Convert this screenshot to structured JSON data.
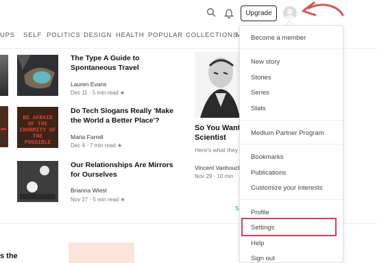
{
  "header": {
    "upgrade_label": "Upgrade"
  },
  "nav": {
    "items": [
      "UPS",
      "SELF",
      "POLITICS",
      "DESIGN",
      "HEALTH",
      "POPULAR",
      "COLLECTIONS",
      "M"
    ]
  },
  "articles": [
    {
      "title": "The Type A Guide to Spontaneous Travel",
      "author": "Lauren Evans",
      "meta": "Dec 11 · 5 min read ★"
    },
    {
      "title": "Do Tech Slogans Really 'Make the World a Better Place'?",
      "author": "Maria Farrell",
      "meta": "Dec 4 · 7 min read ★"
    },
    {
      "title": "Our Relationships Are Mirrors for Ourselves",
      "author": "Brianna Wiest",
      "meta": "Nov 27 · 5 min read ★"
    }
  ],
  "thumb2_text": "BE AFRAID OF THE ENORMITY OF THE POSSIBLE",
  "featured": {
    "title": "So You Want Scientist",
    "subtitle": "Here's what they",
    "author": "Vincent Vanhouck",
    "meta": "Nov 29 · 10 min",
    "see_more": "S"
  },
  "bottom_left": "s the",
  "menu": {
    "become_member": "Become a member",
    "new_story": "New story",
    "stories": "Stories",
    "series": "Series",
    "stats": "Stats",
    "partner": "Medium Partner Program",
    "bookmarks": "Bookmarks",
    "publications": "Publications",
    "customize": "Customize your interests",
    "profile": "Profile",
    "settings": "Settings",
    "help": "Help",
    "signout": "Sign out"
  },
  "colors": {
    "highlight": "#e03a5a",
    "arrow": "#d9534f",
    "green_accent": "#03a87c"
  }
}
